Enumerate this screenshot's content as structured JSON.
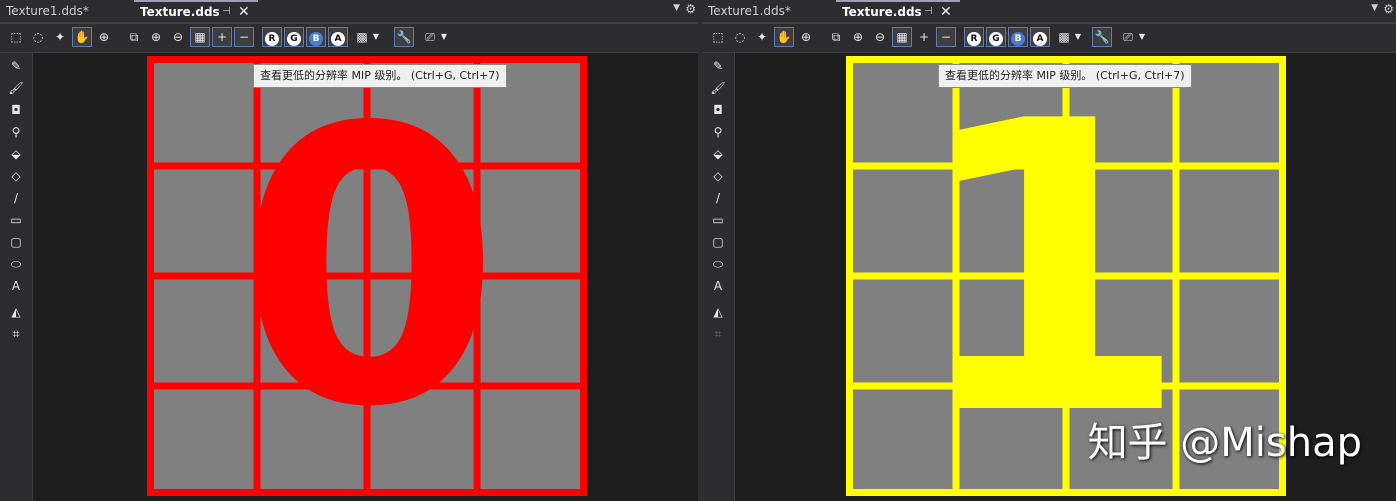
{
  "left": {
    "tabs": [
      {
        "label": "Texture1.dds*",
        "active": false
      },
      {
        "label": "Texture.dds",
        "active": true
      }
    ],
    "tooltip": "查看更低的分辨率 MIP 级别。 (Ctrl+G, Ctrl+7)",
    "texture": {
      "digit": "0",
      "color": "#ff0000"
    }
  },
  "right": {
    "tabs": [
      {
        "label": "Texture1.dds*",
        "active": false
      },
      {
        "label": "Texture.dds",
        "active": true
      }
    ],
    "tooltip": "查看更低的分辨率 MIP 级别。 (Ctrl+G, Ctrl+7)",
    "texture": {
      "digit": "1",
      "color": "#ffff00"
    }
  },
  "common": {
    "pin_glyph": "⊣",
    "close_glyph": "✕",
    "menu_arrow": "▼",
    "gear_glyph": "⚙",
    "channels": [
      "R",
      "G",
      "B",
      "A"
    ],
    "toolbar_icons": [
      "select-icon",
      "lasso-icon",
      "magic-wand-icon",
      "hand-icon",
      "zoom-icon",
      "fit-icon",
      "zoom-in-icon",
      "zoom-out-icon",
      "grid-icon",
      "add-mip-icon",
      "remove-mip-icon",
      "checker-icon",
      "properties-icon",
      "format-icon"
    ],
    "side_icons": [
      "pencil-icon",
      "brush-icon",
      "spray-icon",
      "eyedropper-icon",
      "fill-icon",
      "eraser-icon",
      "line-icon",
      "rectangle-icon",
      "rounded-rect-icon",
      "ellipse-icon",
      "text-icon",
      "flip-icon",
      "crop-icon"
    ],
    "plus": "+",
    "minus": "−",
    "text_tool": "A",
    "colors": {
      "bg": "#1e1e1e",
      "panel": "#2d2d30",
      "texture_gray": "#808080"
    }
  },
  "watermark": "知乎 @Mishap"
}
